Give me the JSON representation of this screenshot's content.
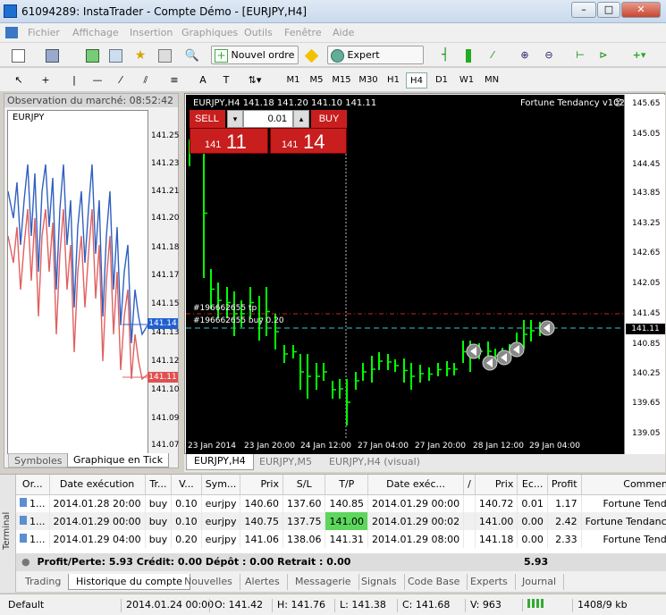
{
  "window": {
    "title": "61094289: InstaTrader - Compte Démo - [EURJPY,H4]",
    "min": "–",
    "max": "□",
    "close": "✕"
  },
  "menu": [
    "Fichier",
    "Affichage",
    "Insertion",
    "Graphiques",
    "Outils",
    "Fenêtre",
    "Aide"
  ],
  "toolbar": {
    "new_order": "Nouvel ordre",
    "expert_advisors": "Expert Advisors"
  },
  "timeframes": [
    "M1",
    "M5",
    "M15",
    "M30",
    "H1",
    "H4",
    "D1",
    "W1",
    "MN"
  ],
  "timeframe_selected": "H4",
  "market_watch": {
    "title": "Observation du marché: 08:52:42",
    "symbol": "EURJPY",
    "yticks": [
      "141.25",
      "141.23",
      "141.21",
      "141.20",
      "141.18",
      "141.17",
      "141.15",
      "141.13",
      "141.12",
      "141.10",
      "141.09",
      "141.07"
    ],
    "bid_label": "141.14",
    "ask_label": "141.11",
    "tabs": [
      "Symboles",
      "Graphique en Tick"
    ]
  },
  "chart": {
    "header": "EURJPY,H4  141.18 141.20 141.10 141.11",
    "ea_label": "Fortune Tendancy v102",
    "sell_label": "SELL",
    "buy_label": "BUY",
    "lot": "0.01",
    "sell_small": "141",
    "sell_big": "11",
    "buy_small": "141",
    "buy_big": "14",
    "order_tp": "#196662655 tp",
    "order_buy": "#196662655 buy 0.20",
    "price_marker": "141.11",
    "right_ticks": [
      "145.65",
      "145.05",
      "144.45",
      "143.85",
      "143.25",
      "142.65",
      "142.05",
      "141.45",
      "140.85",
      "140.25",
      "139.65",
      "139.05"
    ],
    "bottom_ticks": [
      "23 Jan 2014",
      "23 Jan 20:00",
      "24 Jan 12:00",
      "27 Jan 04:00",
      "27 Jan 20:00",
      "28 Jan 12:00",
      "29 Jan 04:00"
    ],
    "tabs": [
      "EURJPY,H4",
      "EURJPY,M5",
      "EURJPY,H4 (visual)"
    ]
  },
  "colors": {
    "bull": "#00ff00",
    "bid": "#1f5fd0",
    "ask": "#e05050",
    "sell_btn": "#c81e1e",
    "tp_cell": "#5cd65c"
  },
  "terminal": {
    "side_label": "Terminal",
    "columns": [
      "Or...",
      "Date exécution",
      "Tr...",
      "V...",
      "Sym...",
      "Prix",
      "S/L",
      "T/P",
      "Date exéc...",
      "/",
      "Prix",
      "Ec...",
      "Profit",
      "Commentaire"
    ],
    "rows": [
      [
        "1...",
        "2014.01.28 20:00",
        "buy",
        "0.10",
        "eurjpy",
        "140.60",
        "137.60",
        "140.85",
        "2014.01.29 00:00",
        "",
        "140.72",
        "0.01",
        "1.17",
        "Fortune Tendancy"
      ],
      [
        "1...",
        "2014.01.29 00:00",
        "buy",
        "0.10",
        "eurjpy",
        "140.75",
        "137.75",
        "141.00",
        "2014.01.29 00:02",
        "",
        "141.00",
        "0.00",
        "2.42",
        "Fortune Tendancy[tp]"
      ],
      [
        "1...",
        "2014.01.29 04:00",
        "buy",
        "0.20",
        "eurjpy",
        "141.06",
        "138.06",
        "141.31",
        "2014.01.29 08:00",
        "",
        "141.18",
        "0.00",
        "2.33",
        "Fortune Tendancy"
      ]
    ],
    "summary": "Profit/Perte: 5.93  Crédit: 0.00  Dépôt : 0.00  Retrait : 0.00",
    "summary_total": "5.93",
    "tabs": [
      "Trading",
      "Historique du compte",
      "Nouvelles",
      "Alertes",
      "Messagerie",
      "Signals",
      "Code Base",
      "Experts",
      "Journal"
    ]
  },
  "status": {
    "profile": "Default",
    "datetime": "2014.01.24 00:00",
    "open": "O: 141.42",
    "high": "H: 141.76",
    "low": "L: 141.38",
    "close": "C: 141.68",
    "volume": "V: 963",
    "traffic": "1408/9 kb"
  }
}
